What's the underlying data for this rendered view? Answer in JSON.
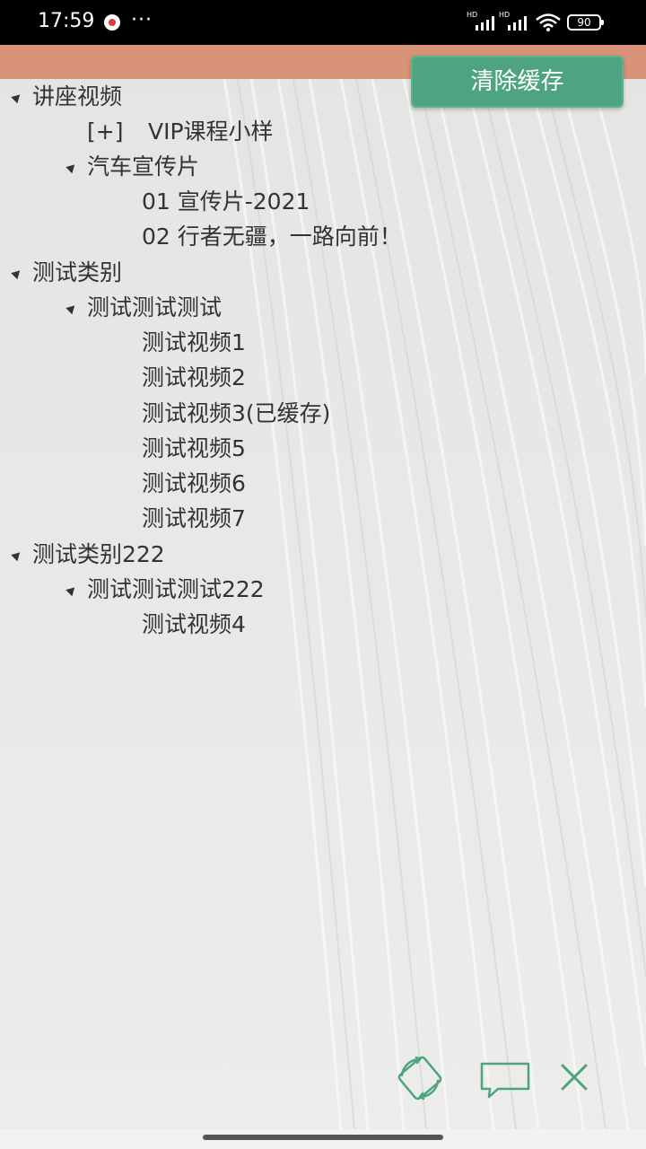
{
  "status_bar": {
    "time": "17:59",
    "more": "···",
    "network_1": "HD",
    "network_2": "HD",
    "battery": "90"
  },
  "header": {
    "clear_cache_label": "清除缓存"
  },
  "tree": {
    "cat1": {
      "label": "讲座视频",
      "sub1": {
        "prefix": "[+]",
        "label": "VIP课程小样"
      },
      "sub2": {
        "label": "汽车宣传片",
        "items": [
          "01 宣传片-2021",
          "02 行者无疆，一路向前！"
        ]
      }
    },
    "cat2": {
      "label": "测试类别",
      "sub1": {
        "label": "测试测试测试",
        "items": [
          "测试视频1",
          "测试视频2",
          "测试视频3(已缓存)",
          "测试视频5",
          "测试视频6",
          "测试视频7"
        ]
      }
    },
    "cat3": {
      "label": "测试类别222",
      "sub1": {
        "label": "测试测试测试222",
        "items": [
          "测试视频4"
        ]
      }
    }
  },
  "bottom_bar": {
    "rotate_icon": "screen-rotate-icon",
    "comment_icon": "comment-icon",
    "close_icon": "close-icon",
    "accent_color": "#4ea481"
  }
}
